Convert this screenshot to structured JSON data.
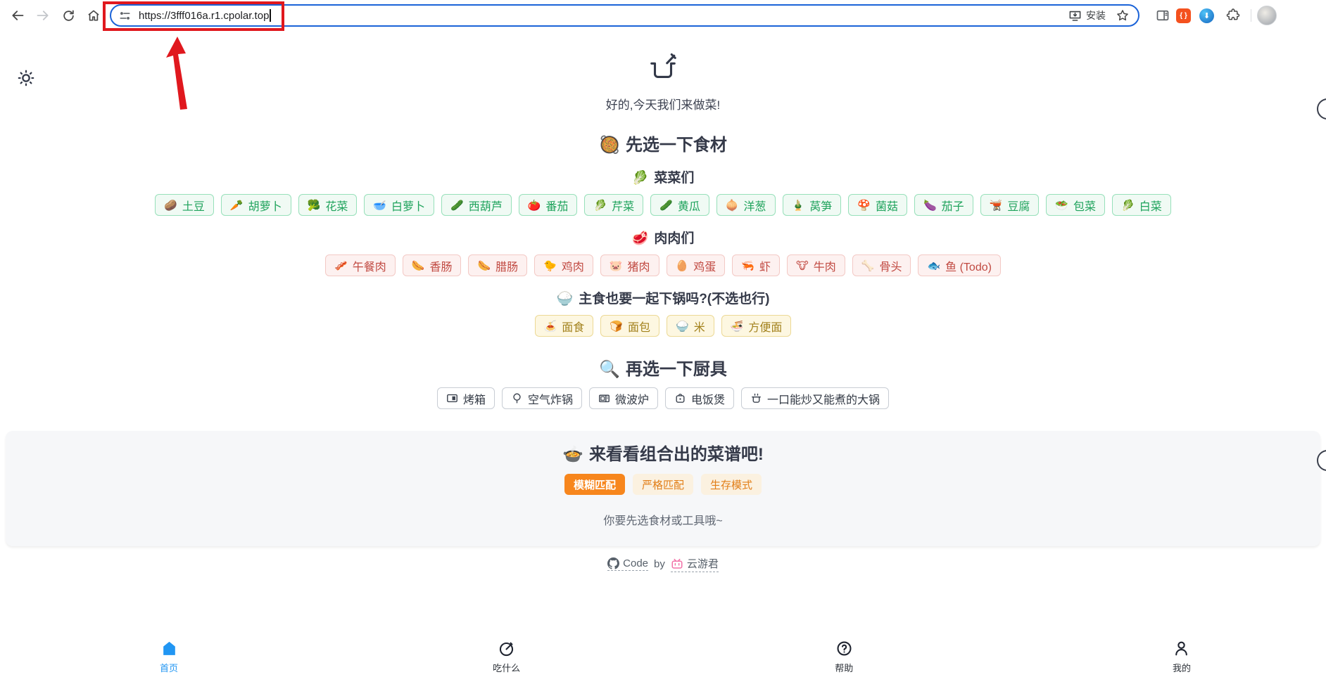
{
  "browser": {
    "url": "https://3fff016a.r1.cpolar.top",
    "install_label": "安装"
  },
  "hero": {
    "greeting": "好的,今天我们来做菜!"
  },
  "ingredients": {
    "title": "先选一下食材",
    "title_emoji": "🥘",
    "veg": {
      "name": "菜菜们",
      "emoji": "🥬",
      "items": [
        {
          "emoji": "🥔",
          "label": "土豆"
        },
        {
          "emoji": "🥕",
          "label": "胡萝卜"
        },
        {
          "emoji": "🥦",
          "label": "花菜"
        },
        {
          "emoji": "🥣",
          "label": "白萝卜"
        },
        {
          "emoji": "🥒",
          "label": "西葫芦"
        },
        {
          "emoji": "🍅",
          "label": "番茄"
        },
        {
          "emoji": "🥬",
          "label": "芹菜"
        },
        {
          "emoji": "🥒",
          "label": "黄瓜"
        },
        {
          "emoji": "🧅",
          "label": "洋葱"
        },
        {
          "emoji": "🎍",
          "label": "莴笋"
        },
        {
          "emoji": "🍄",
          "label": "菌菇"
        },
        {
          "emoji": "🍆",
          "label": "茄子"
        },
        {
          "emoji": "🫕",
          "label": "豆腐"
        },
        {
          "emoji": "🥗",
          "label": "包菜"
        },
        {
          "emoji": "🥬",
          "label": "白菜"
        }
      ]
    },
    "meat": {
      "name": "肉肉们",
      "emoji": "🥩",
      "items": [
        {
          "emoji": "🥓",
          "label": "午餐肉"
        },
        {
          "emoji": "🌭",
          "label": "香肠"
        },
        {
          "emoji": "🌭",
          "label": "腊肠"
        },
        {
          "emoji": "🐤",
          "label": "鸡肉"
        },
        {
          "emoji": "🐷",
          "label": "猪肉"
        },
        {
          "emoji": "🥚",
          "label": "鸡蛋"
        },
        {
          "emoji": "🦐",
          "label": "虾"
        },
        {
          "emoji": "🐮",
          "label": "牛肉"
        },
        {
          "emoji": "🦴",
          "label": "骨头"
        },
        {
          "emoji": "🐟",
          "label": "鱼 (Todo)"
        }
      ]
    },
    "staple": {
      "name": "主食也要一起下锅吗?(不选也行)",
      "emoji": "🍚",
      "items": [
        {
          "emoji": "🍝",
          "label": "面食"
        },
        {
          "emoji": "🍞",
          "label": "面包"
        },
        {
          "emoji": "🍚",
          "label": "米"
        },
        {
          "emoji": "🍜",
          "label": "方便面"
        }
      ]
    }
  },
  "tools": {
    "title": "再选一下厨具",
    "title_emoji": "🔍",
    "items": [
      {
        "icon": "oven-icon",
        "label": "烤箱"
      },
      {
        "icon": "air-fryer-icon",
        "label": "空气炸锅"
      },
      {
        "icon": "microwave-icon",
        "label": "微波炉"
      },
      {
        "icon": "rice-cooker-icon",
        "label": "电饭煲"
      },
      {
        "icon": "big-pot-icon",
        "label": "一口能炒又能煮的大锅"
      }
    ]
  },
  "recipes": {
    "title": "来看看组合出的菜谱吧!",
    "title_emoji": "🍲",
    "tabs": [
      {
        "label": "模糊匹配",
        "active": true
      },
      {
        "label": "严格匹配",
        "active": false
      },
      {
        "label": "生存模式",
        "active": false
      }
    ],
    "hint": "你要先选食材或工具哦~"
  },
  "footer": {
    "code": "Code",
    "by": "by",
    "author": "云游君"
  },
  "bottom_nav": [
    {
      "label": "首页",
      "active": true
    },
    {
      "label": "吃什么",
      "active": false
    },
    {
      "label": "帮助",
      "active": false
    },
    {
      "label": "我的",
      "active": false
    }
  ],
  "colors": {
    "omnibox_focus_blue": "#1b63d8",
    "annotation_red": "#e0181e",
    "tab_orange": "#f7861d",
    "nav_active_blue": "#2196f3",
    "veg_green": "#1fa35c",
    "meat_red": "#c14a42",
    "staple_yellow": "#a3821d"
  }
}
